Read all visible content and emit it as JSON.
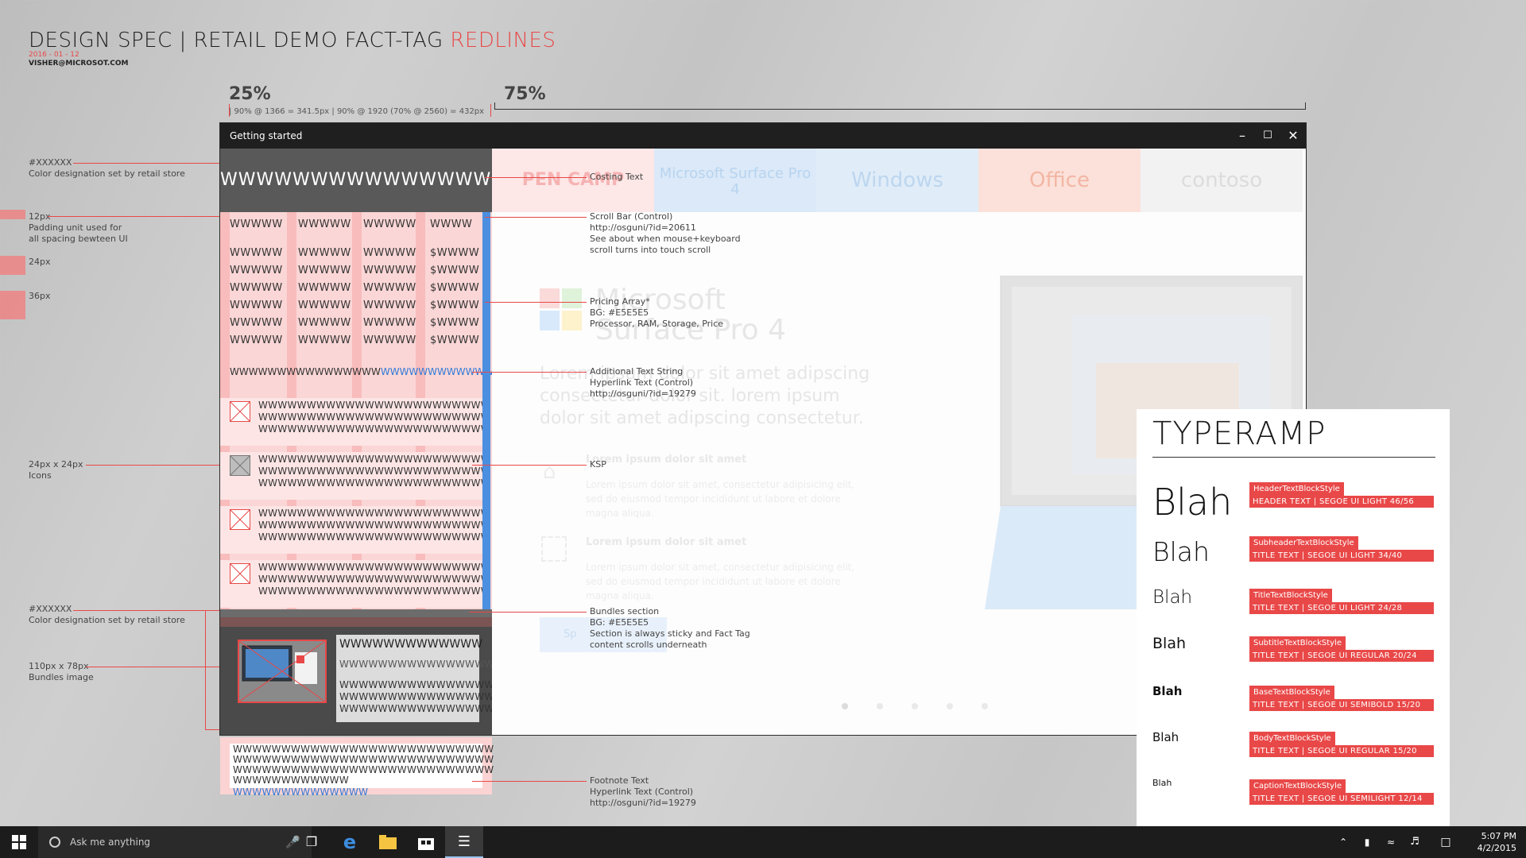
{
  "doc": {
    "title_prefix": "DESIGN SPEC | RETAIL DEMO FACT-TAG ",
    "title_accent": "REDLINES",
    "date": "2016 - 01 - 12",
    "email": "VISHER@MICROSOT.COM",
    "accent_color": "#e94848"
  },
  "ruler": {
    "left_pct": "25%",
    "right_pct": "75%",
    "left_note": "| 90% @ 1366 = 341.5px | 90% @ 1920 (70% @ 2560) = 432px"
  },
  "left_notes": {
    "color1_code": "#XXXXXX",
    "color1_desc": "Color designation set by retail store",
    "pad_size": "12px",
    "pad_desc1": "Padding unit used for",
    "pad_desc2": "all spacing bewteen UI",
    "size24": "24px",
    "size36": "36px",
    "icons_size": "24px x 24px",
    "icons_label": "Icons",
    "color2_code": "#XXXXXX",
    "color2_desc": "Color designation set by retail store",
    "bundle_size": "110px x 78px",
    "bundle_label": "Bundles image"
  },
  "window": {
    "title": "Getting started",
    "min_icon": "minimize-icon",
    "max_icon": "maximize-icon",
    "close_icon": "close-icon"
  },
  "fact_tag": {
    "costing_text": "WWWWWWWWWWWWWWWW",
    "header_row": [
      "WWWWW",
      "WWWWW",
      "WWWWW",
      "WWWW"
    ],
    "pricing_rows": [
      [
        "WWWWW",
        "WWWWW",
        "WWWWW",
        "$WWWW"
      ],
      [
        "WWWWW",
        "WWWWW",
        "WWWWW",
        "$WWWW"
      ],
      [
        "WWWWW",
        "WWWWW",
        "WWWWW",
        "$WWWW"
      ],
      [
        "WWWWW",
        "WWWWW",
        "WWWWW",
        "$WWWW"
      ],
      [
        "WWWWW",
        "WWWWW",
        "WWWWW",
        "$WWWW"
      ],
      [
        "WWWWW",
        "WWWWW",
        "WWWWW",
        "$WWWW"
      ]
    ],
    "additional_text": "WWWWWWWWWWWWWWWW",
    "additional_link": "WWWWWWWWWWWW",
    "ksp_line": "WWWWWWWWWWWWWWWWWWWWWWWW",
    "bundle_title": "WWWWWWWWWWWWW",
    "bundle_line": "WWWWWWWWWWWWWWWWW",
    "footnote_line": "WWWWWWWWWWWWWWWWWWWWWWWWWWW",
    "footnote_text": "WWWWWWWWWWWW",
    "footnote_link": "WWWWWWWWWWWWWW"
  },
  "annotations": {
    "costing": "Costing Text",
    "scroll_1": "Scroll Bar (Control)",
    "scroll_2": "http://osguni/?id=20611",
    "scroll_3": "See about when mouse+keyboard",
    "scroll_4": "scroll turns into touch scroll",
    "pricing_1": "Pricing Array*",
    "pricing_2": "BG: #E5E5E5",
    "pricing_3": "Processor, RAM, Storage, Price",
    "additional_1": "Additional Text String",
    "additional_2": "Hyperlink Text (Control)",
    "additional_3": "http://osguni/?id=19279",
    "ksp": "KSP",
    "bundles_1": "Bundles section",
    "bundles_2": "BG: #E5E5E5",
    "bundles_3": "Section is always sticky and Fact Tag",
    "bundles_4": "content scrolls underneath",
    "footnote_1": "Footnote Text",
    "footnote_2": "Hyperlink Text (Control)",
    "footnote_3": "http://osguni/?id=19279"
  },
  "hero": {
    "tiles": [
      "PEN CAMP",
      "Microsoft Surface Pro 4",
      "Windows",
      "Office",
      "contoso"
    ],
    "title_1": "Microsoft",
    "title_2": "Surface Pro 4",
    "body": "Lorem ipsum dolor sit amet adipscing consectetur dolor sit. lorem ipsum dolor sit amet adipscing consectetur.",
    "feat1_h": "Lorem ipsum dolor sit amet",
    "feat1_b": "Lorem ipsum dolor sit amet, consectetur adipisicing elit, sed do eiusmod tempor incididunt ut labore et dolore magna aliqua.",
    "feat2_h": "Lorem ipsum dolor sit amet",
    "feat2_b": "Lorem ipsum dolor sit amet, consectetur adipisicing elit, sed do eiusmod tempor incididunt ut labore et dolore magna aliqua.",
    "cta": "Sp"
  },
  "typeramp": {
    "title": "TYPERAMP",
    "items": [
      {
        "sample": "Blah",
        "style": "HeaderTextBlockStyle",
        "spec": "HEADER TEXT | SEGOE UI LIGHT 46/56"
      },
      {
        "sample": "Blah",
        "style": "SubheaderTextBlockStyle",
        "spec": "TITLE TEXT | SEGOE UI LIGHT 34/40"
      },
      {
        "sample": "Blah",
        "style": "TitleTextBlockStyle",
        "spec": "TITLE TEXT | SEGOE UI LIGHT 24/28"
      },
      {
        "sample": "Blah",
        "style": "SubtitleTextBlockStyle",
        "spec": "TITLE TEXT | SEGOE UI REGULAR 20/24"
      },
      {
        "sample": "Blah",
        "style": "BaseTextBlockStyle",
        "spec": "TITLE TEXT | SEGOE UI SEMIBOLD 15/20"
      },
      {
        "sample": "Blah",
        "style": "BodyTextBlockStyle",
        "spec": "TITLE TEXT | SEGOE UI REGULAR 15/20"
      },
      {
        "sample": "Blah",
        "style": "CaptionTextBlockStyle",
        "spec": "TITLE TEXT | SEGOE UI SEMILIGHT 12/14"
      }
    ]
  },
  "taskbar": {
    "search_placeholder": "Ask me anything",
    "time": "5:07 PM",
    "date": "4/2/2015"
  }
}
